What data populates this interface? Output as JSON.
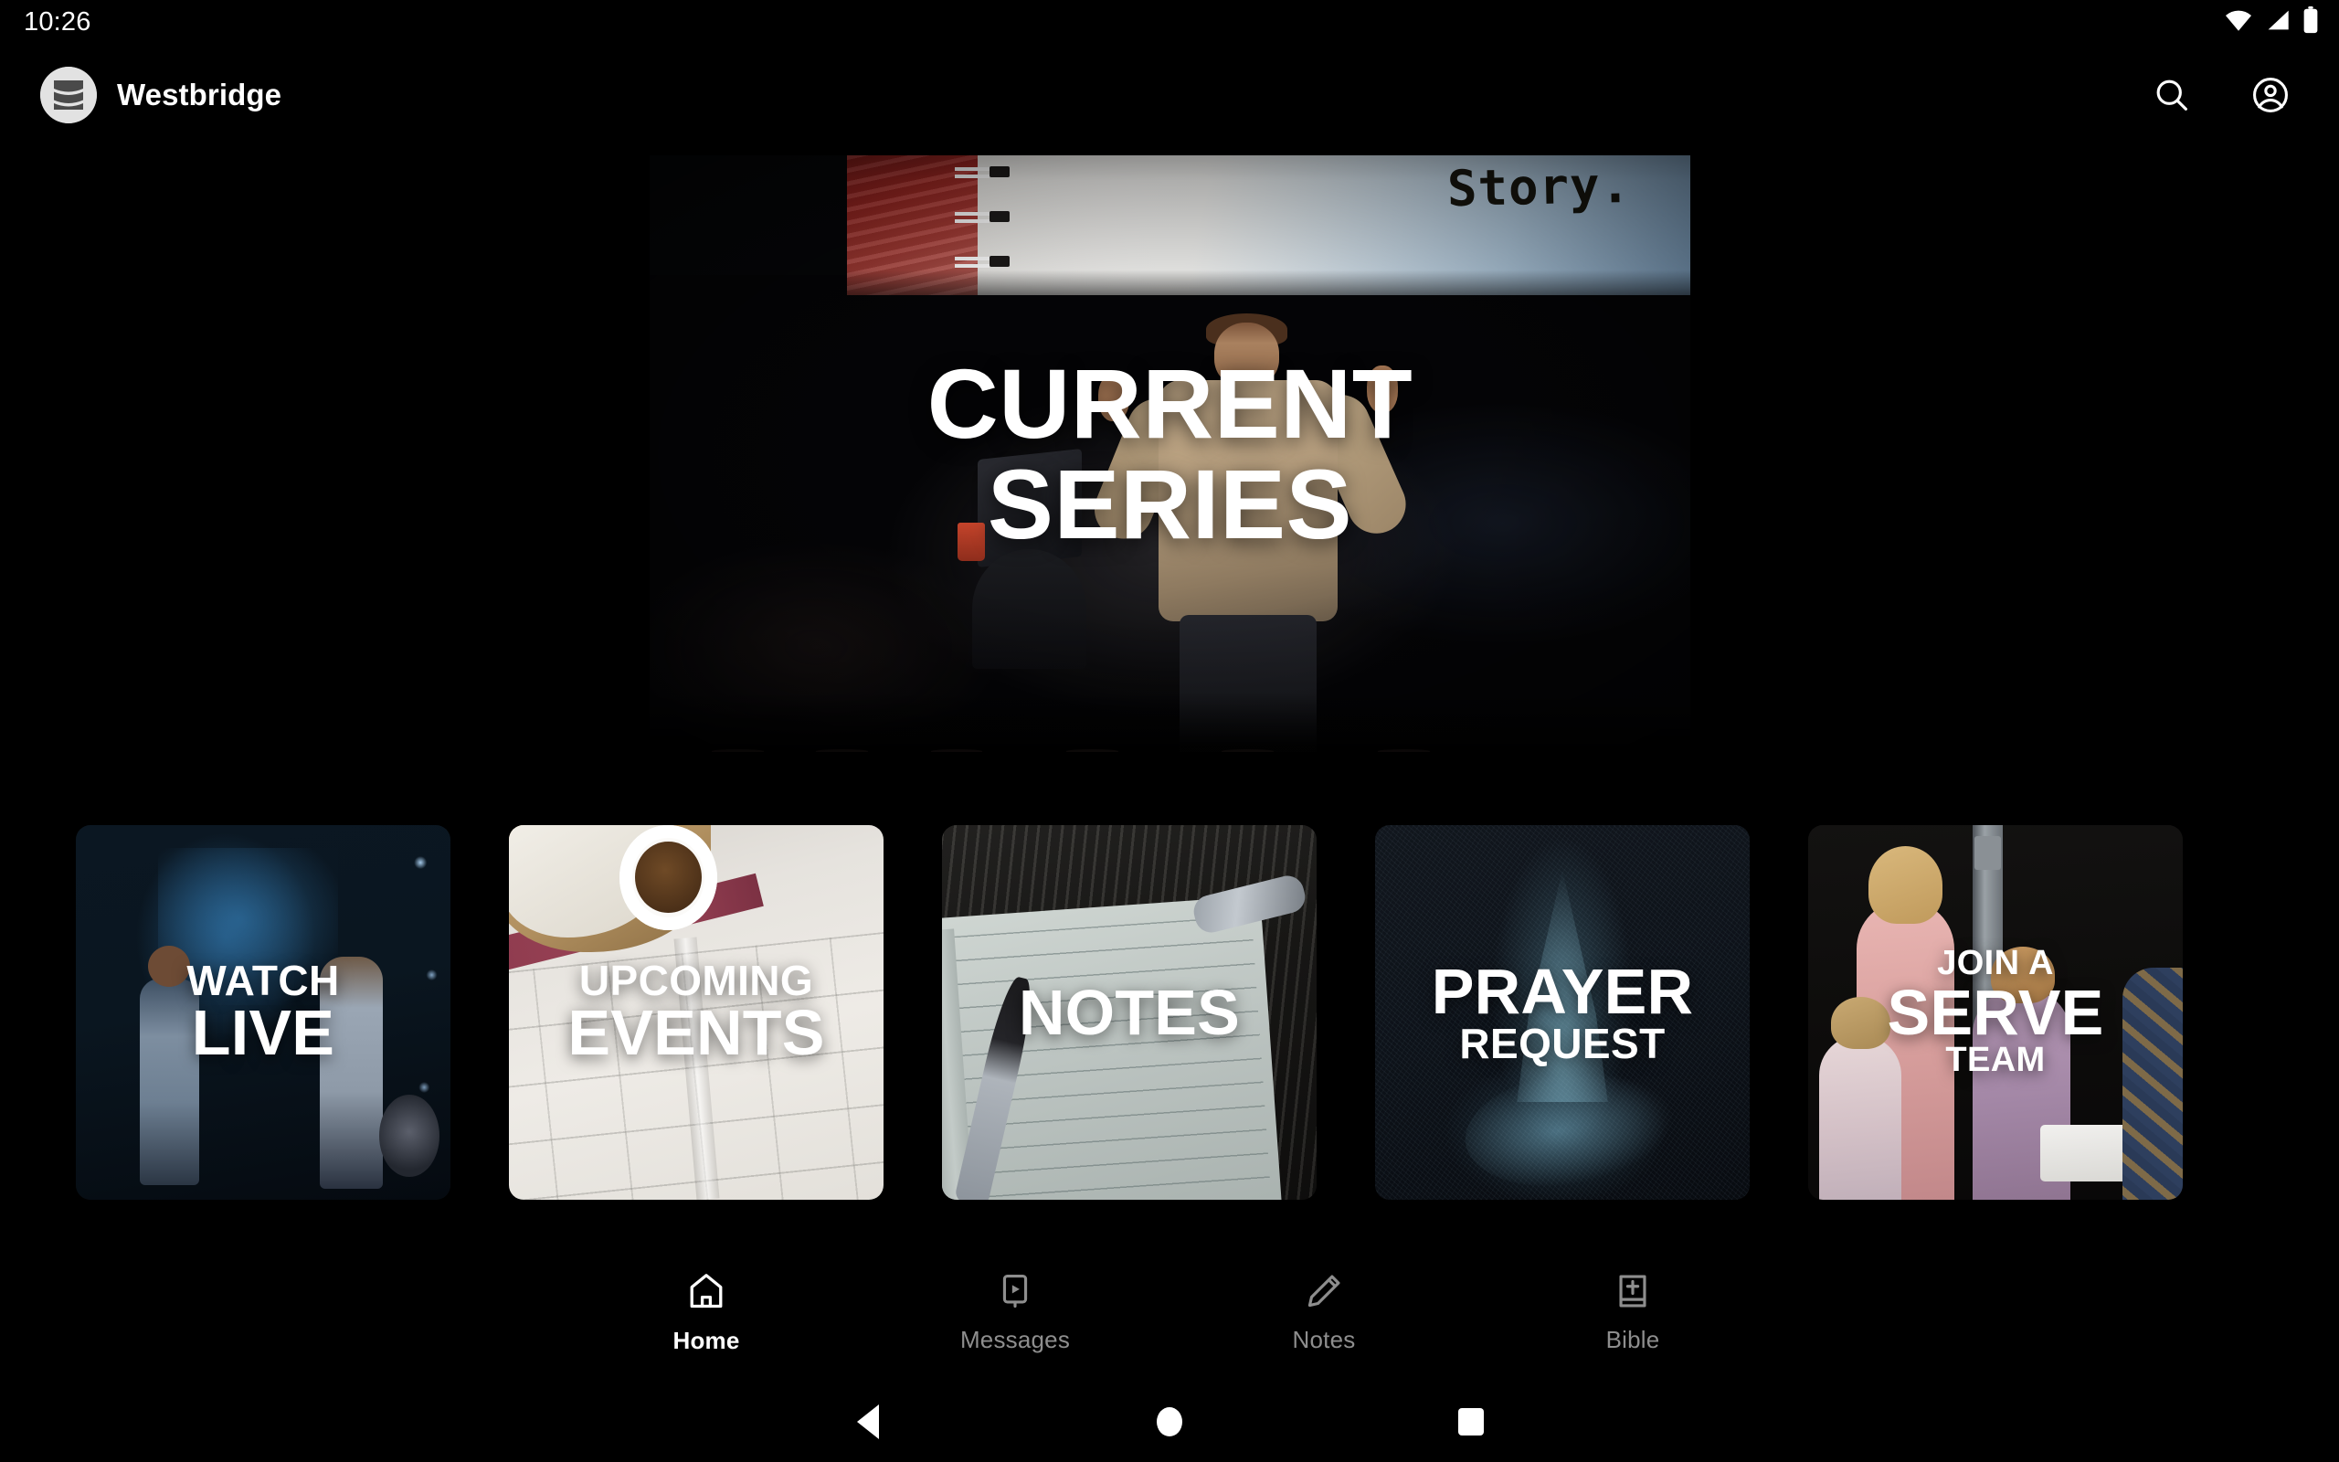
{
  "status_bar": {
    "time": "10:26",
    "icons": [
      "wifi-icon",
      "signal-icon",
      "battery-icon"
    ]
  },
  "app_bar": {
    "brand_name": "Westbridge",
    "logo": "westbridge-logo",
    "actions": [
      {
        "name": "search-icon",
        "label": "Search"
      },
      {
        "name": "account-icon",
        "label": "Account"
      }
    ]
  },
  "hero": {
    "title_line1": "CURRENT",
    "title_line2": "SERIES",
    "projected_text": "Story.",
    "alt": "Speaker on a dark stage gesturing in front of a projected notebook graphic"
  },
  "cards": [
    {
      "id": "watch-live",
      "line1": "WATCH",
      "line2": "LIVE",
      "alt": "Worship band performing on a blue-lit stage"
    },
    {
      "id": "upcoming-events",
      "line1": "UPCOMING",
      "line2": "EVENTS",
      "alt": "Open paper calendar beside a bread basket and coffee cup"
    },
    {
      "id": "notes",
      "line1": "",
      "line2": "NOTES",
      "alt": "Open lined notebook with a fountain pen on dark wood"
    },
    {
      "id": "prayer-request",
      "line1": "PRAYER",
      "line2": "REQUEST",
      "alt": "Blue particle plume on a dark textured background"
    },
    {
      "id": "serve-team",
      "line1": "JOIN A",
      "line2": "SERVE",
      "line3": "TEAM",
      "alt": "Volunteers and children holding a supply basket"
    }
  ],
  "bottom_nav": {
    "items": [
      {
        "label": "Home",
        "icon": "home-icon",
        "active": true
      },
      {
        "label": "Messages",
        "icon": "messages-icon",
        "active": false
      },
      {
        "label": "Notes",
        "icon": "pencil-icon",
        "active": false
      },
      {
        "label": "Bible",
        "icon": "bible-icon",
        "active": false
      }
    ]
  },
  "system_nav": {
    "back": "back-button",
    "home": "home-button",
    "recents": "recents-button"
  },
  "colors": {
    "background": "#000000",
    "text_primary": "#ffffff",
    "text_muted": "#8e8e8e",
    "logo_circle": "#e2e2e2",
    "logo_bands": "#4a4a4a"
  }
}
